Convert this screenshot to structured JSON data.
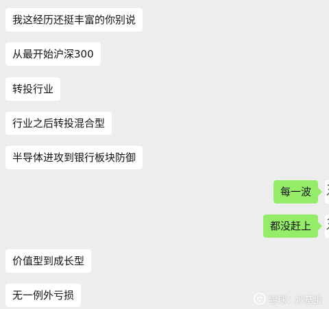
{
  "messages": [
    {
      "side": "left",
      "text": "我这经历还挺丰富的你别说"
    },
    {
      "side": "left",
      "text": "从最开始沪深300"
    },
    {
      "side": "left",
      "text": "转投行业"
    },
    {
      "side": "left",
      "text": "行业之后转投混合型"
    },
    {
      "side": "left",
      "text": "半导体进攻到银行板块防御"
    },
    {
      "side": "right",
      "text": "每一波"
    },
    {
      "side": "right",
      "text": "都没赶上"
    },
    {
      "side": "left",
      "text": "价值型到成长型"
    },
    {
      "side": "left",
      "text": "无一例外亏损"
    }
  ],
  "watermark": {
    "text": "雪球：炒基蛋",
    "icon": "snowball-logo-icon"
  },
  "colors": {
    "background": "#ededed",
    "left_bubble": "#ffffff",
    "right_bubble": "#95ec69",
    "text": "#111111"
  }
}
